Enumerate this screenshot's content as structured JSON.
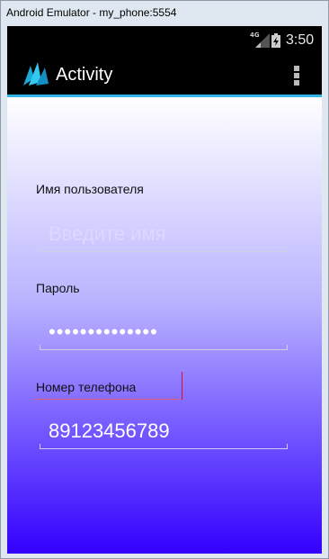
{
  "window": {
    "title": "Android Emulator - my_phone:5554"
  },
  "status_bar": {
    "network": "4G",
    "time": "3:50"
  },
  "action_bar": {
    "title": "Activity",
    "overflow_icon": "more-vert-icon",
    "logo_icon": "app-logo-icon",
    "accent": "#33b5e5"
  },
  "form": {
    "username": {
      "label": "Имя пользователя",
      "placeholder": "Введите имя"
    },
    "password": {
      "label": "Пароль",
      "value": "••••••••••••••"
    },
    "phone": {
      "label": "Номер телефона",
      "value": "89123456789"
    }
  },
  "colors": {
    "gradient_top": "#ffffff",
    "gradient_bottom": "#3300ff",
    "focus_accent": "#d01040"
  }
}
